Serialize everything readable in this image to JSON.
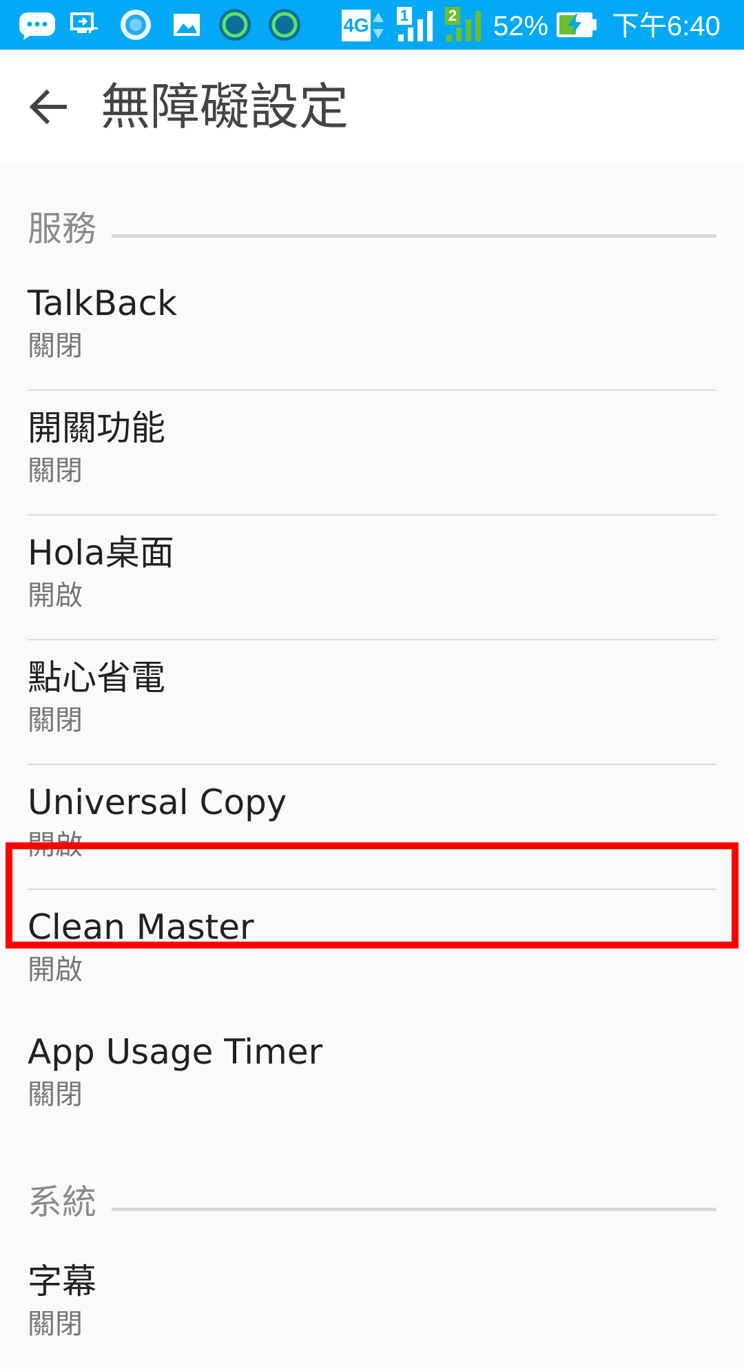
{
  "status_bar": {
    "signal_1_label": "1",
    "signal_2_label": "2",
    "network_type": "4G",
    "battery": "52%",
    "time": "下午6:40",
    "icons": [
      "chat-bubble-icon",
      "screen-cast-icon",
      "circle-app-icon",
      "gallery-icon",
      "ring-app-icon",
      "ring-app-icon-2",
      "network-4g-icon",
      "signal-sim1-icon",
      "signal-sim2-icon",
      "battery-charging-icon"
    ],
    "colors": {
      "background": "#03a9f4",
      "sim2_signal": "#6ebd2e"
    }
  },
  "header": {
    "title": "無障礙設定",
    "back_icon": "arrow-back-icon"
  },
  "sections": [
    {
      "title": "服務",
      "items": [
        {
          "title": "TalkBack",
          "summary": "關閉"
        },
        {
          "title": "開關功能",
          "summary": "關閉"
        },
        {
          "title": "Hola桌面",
          "summary": "開啟"
        },
        {
          "title": "點心省電",
          "summary": "關閉"
        },
        {
          "title": "Universal Copy",
          "summary": "開啟"
        },
        {
          "title": "Clean Master",
          "summary": "開啟"
        },
        {
          "title": "App Usage Timer",
          "summary": "關閉"
        }
      ]
    },
    {
      "title": "系統",
      "items": [
        {
          "title": "字幕",
          "summary": "關閉"
        }
      ]
    }
  ],
  "highlight_color": "#ff0000"
}
